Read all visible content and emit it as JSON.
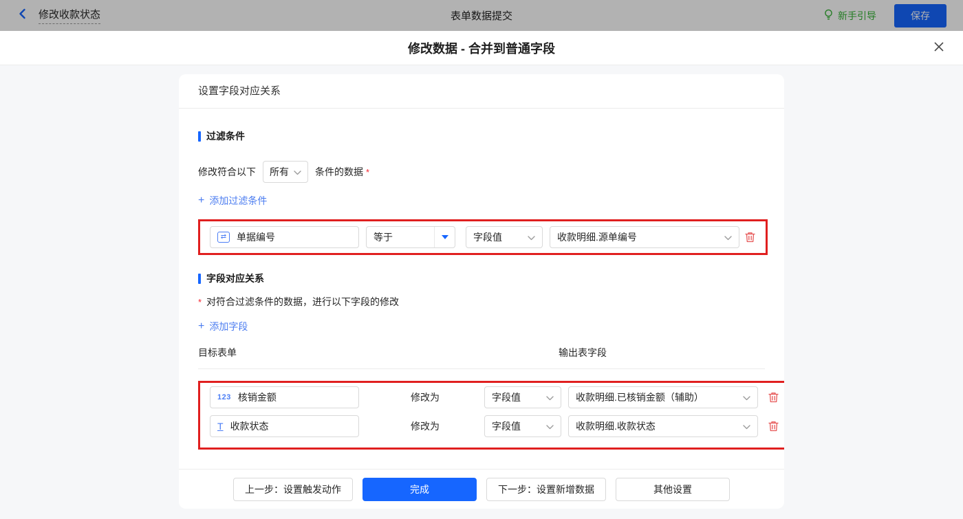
{
  "topbar": {
    "back_title": "修改收款状态",
    "center_title": "表单数据提交",
    "guide_label": "新手引导",
    "save_label": "保存"
  },
  "modal": {
    "title": "修改数据 - 合并到普通字段"
  },
  "panel": {
    "header": "设置字段对应关系"
  },
  "filter": {
    "section_title": "过滤条件",
    "prefix": "修改符合以下",
    "scope_value": "所有",
    "suffix": "条件的数据",
    "required_mark": "*",
    "add_plus": "+",
    "add_label": "添加过滤条件",
    "row": {
      "field_icon_glyph": "⇄",
      "field_label": "单据编号",
      "operator": "等于",
      "value_type": "字段值",
      "value": "收款明细.源单编号"
    }
  },
  "mapping": {
    "section_title": "字段对应关系",
    "required_mark": "*",
    "note": "对符合过滤条件的数据，进行以下字段的修改",
    "add_plus": "+",
    "add_label": "添加字段",
    "columns": {
      "target": "目标表单",
      "output": "输出表字段"
    },
    "modify_label": "修改为",
    "rows": [
      {
        "field_icon_glyph": "123",
        "field_label": "核销金额",
        "value_type": "字段值",
        "value": "收款明细.已核销金额（辅助）"
      },
      {
        "field_icon_glyph": "T",
        "field_label": "收款状态",
        "value_type": "字段值",
        "value": "收款明细.收款状态"
      }
    ]
  },
  "footer": {
    "prev": "上一步：设置触发动作",
    "done": "完成",
    "next": "下一步：设置新增数据",
    "other": "其他设置"
  },
  "colors": {
    "primary": "#1666ff",
    "link_blue": "#4c7df0",
    "highlight_red": "#e01f1f",
    "danger_red": "#e65555",
    "guide_green": "#36b336"
  }
}
